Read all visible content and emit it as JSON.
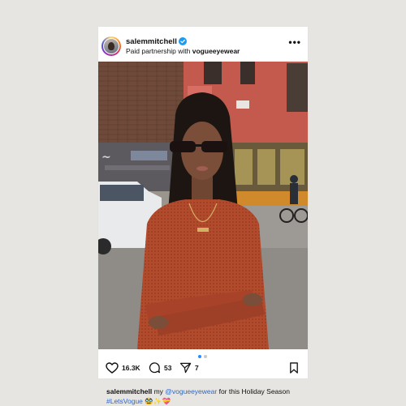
{
  "post": {
    "username": "salemmitchell",
    "verified": true,
    "subtitle_prefix": "Paid partnership with",
    "partner": "vogueeyewear",
    "more_label": "•••",
    "carousel": {
      "count": 2,
      "active_index": 0
    },
    "likes": "16.3K",
    "comments": "53",
    "shares": "7",
    "caption": {
      "user": "salemmitchell",
      "text_1": " my ",
      "mention": "@vogueeyewear",
      "text_2": " for this Holiday Season ",
      "hashtag": "#LetsVogue",
      "emojis": "🥸✨💝"
    }
  },
  "colors": {
    "accent_link": "#2f68c5",
    "verified_badge": "#1d9bf0",
    "dot_active": "#1e90ff",
    "dot_inactive": "#c8c8c8"
  },
  "icons": {
    "like": "heart-icon",
    "comment": "comment-bubble-icon",
    "share": "paper-plane-icon",
    "save": "bookmark-icon",
    "verified": "verified-badge-icon"
  }
}
